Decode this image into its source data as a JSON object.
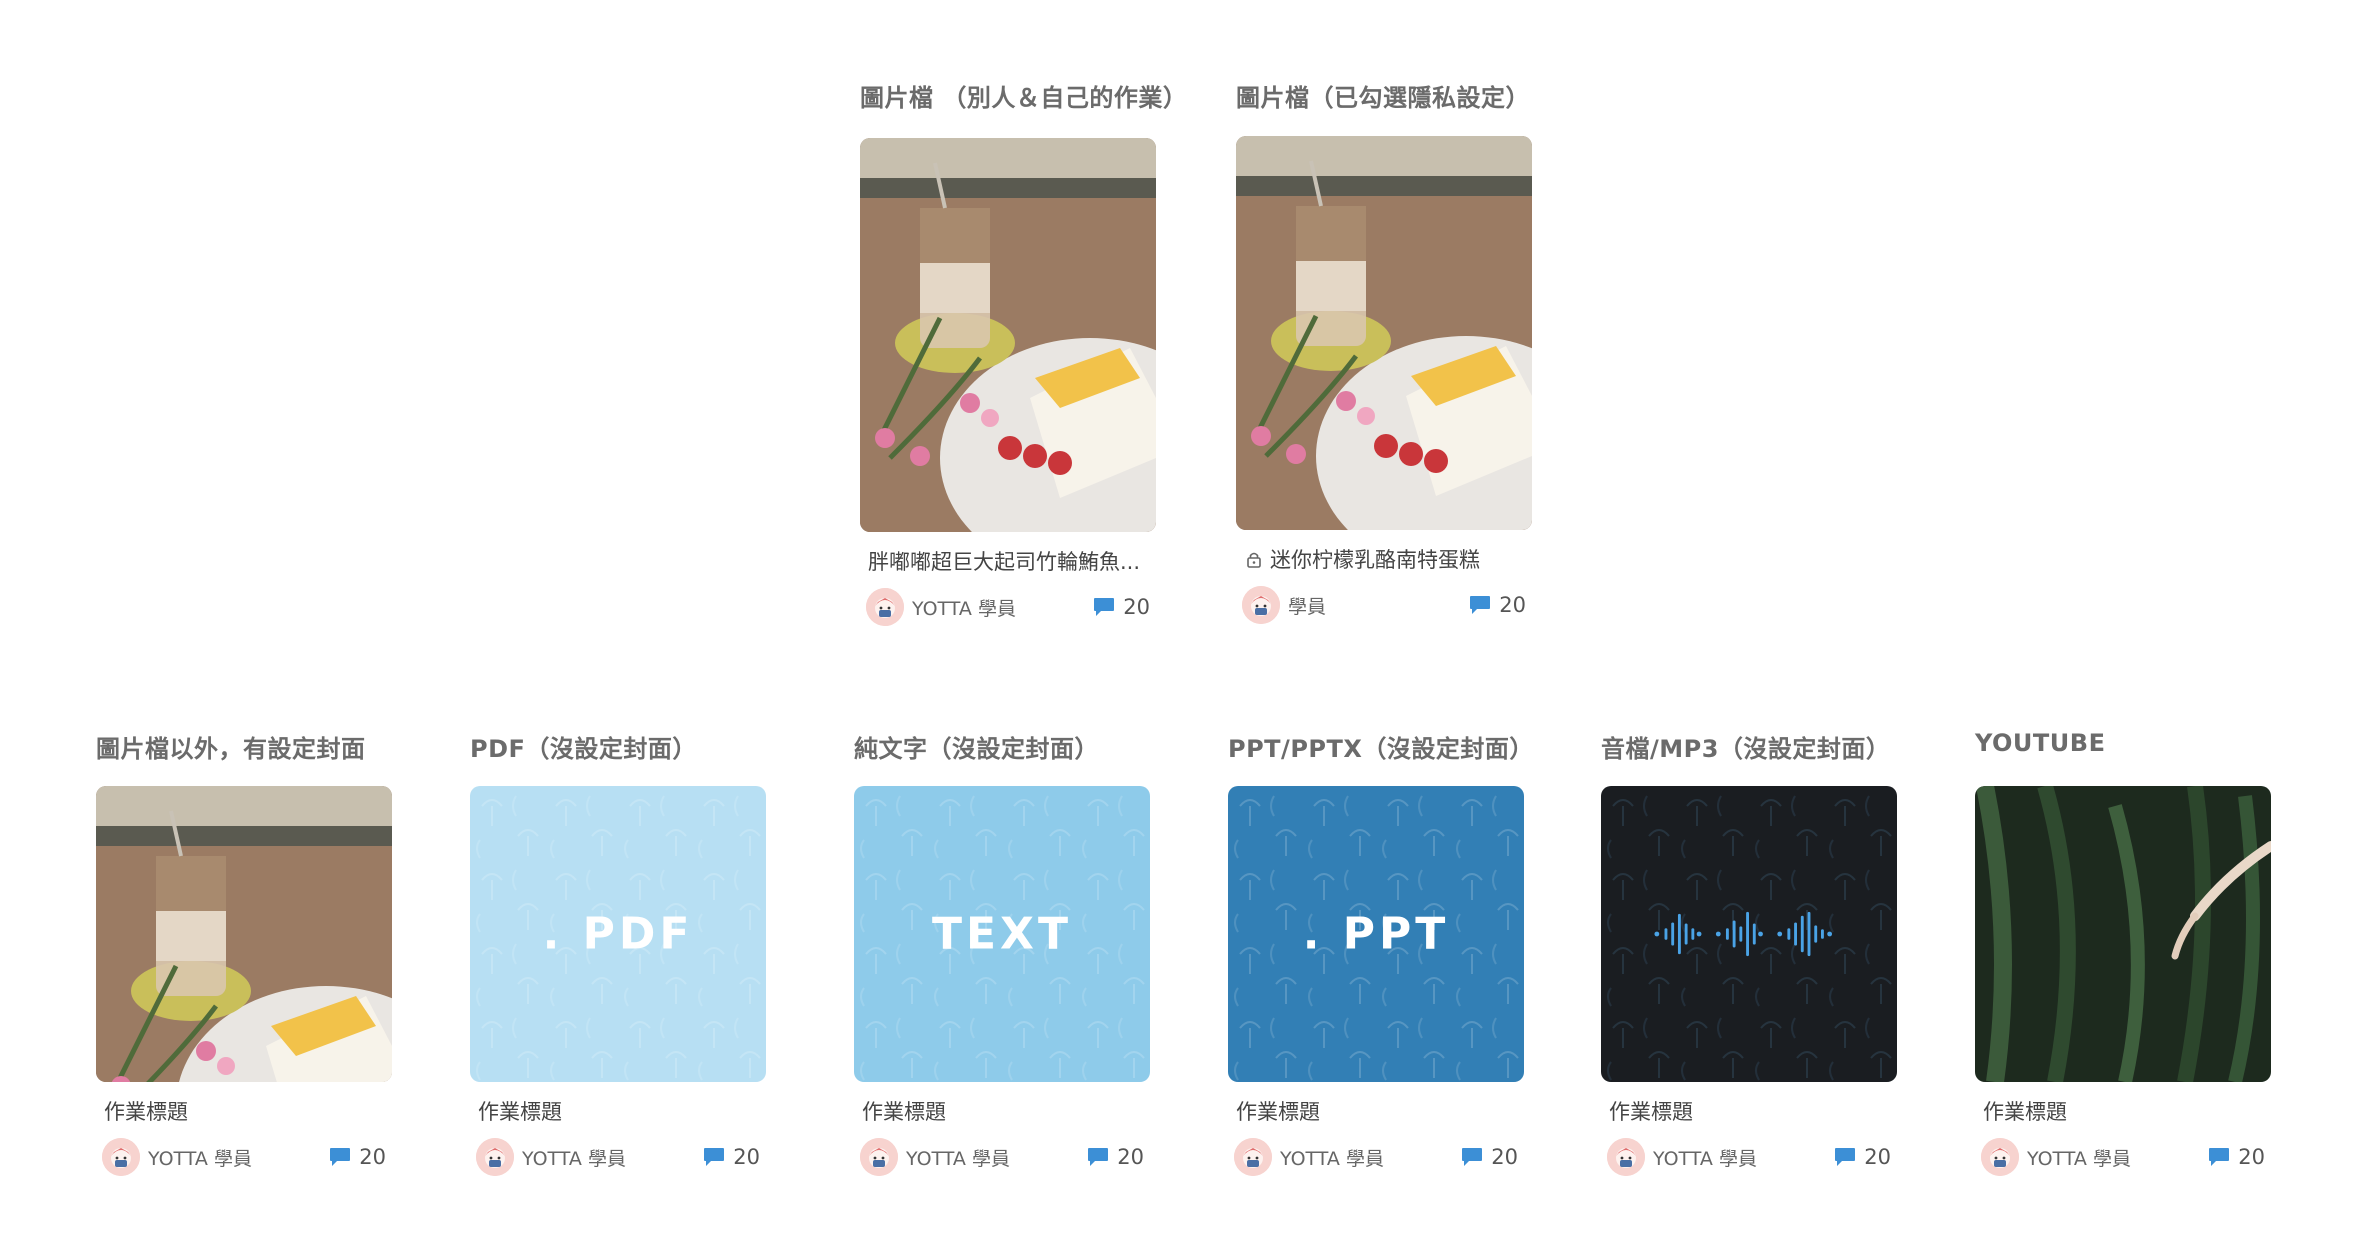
{
  "sections": {
    "image_public": "圖片檔 （別人＆自己的作業）",
    "image_private": "圖片檔（已勾選隱私設定）",
    "other_with_cover": "圖片檔以外，有設定封面",
    "pdf": "PDF（沒設定封面）",
    "text": "純文字（沒設定封面）",
    "ppt": "PPT/PPTX（沒設定封面）",
    "audio": "音檔/MP3（沒設定封面）",
    "youtube": "YOUTUBE"
  },
  "cards": [
    {
      "title": "胖嘟嘟超巨大起司竹輪鮪魚...",
      "author": "YOTTA 學員",
      "comments": "20",
      "private": false
    },
    {
      "title": "迷你柠檬乳酪南特蛋糕",
      "author": "學員",
      "comments": "20",
      "private": true
    },
    {
      "title": "作業標題",
      "author": "YOTTA 學員",
      "comments": "20"
    },
    {
      "title": "作業標題",
      "author": "YOTTA 學員",
      "comments": "20",
      "cover_text": ". PDF"
    },
    {
      "title": "作業標題",
      "author": "YOTTA 學員",
      "comments": "20",
      "cover_text": "TEXT"
    },
    {
      "title": "作業標題",
      "author": "YOTTA 學員",
      "comments": "20",
      "cover_text": ". PPT"
    },
    {
      "title": "作業標題",
      "author": "YOTTA 學員",
      "comments": "20"
    },
    {
      "title": "作業標題",
      "author": "YOTTA 學員",
      "comments": "20"
    }
  ],
  "colors": {
    "pdf_bg": "#b7dff3",
    "text_bg": "#8ecbea",
    "ppt_bg": "#327fb5",
    "audio_bg": "#1a1d21",
    "audio_wave": "#4aa3e6",
    "comment_icon": "#3c8fd6"
  },
  "icons": {
    "comment": "speech-bubble-icon",
    "lock": "lock-icon",
    "audio": "sound-wave-icon"
  }
}
